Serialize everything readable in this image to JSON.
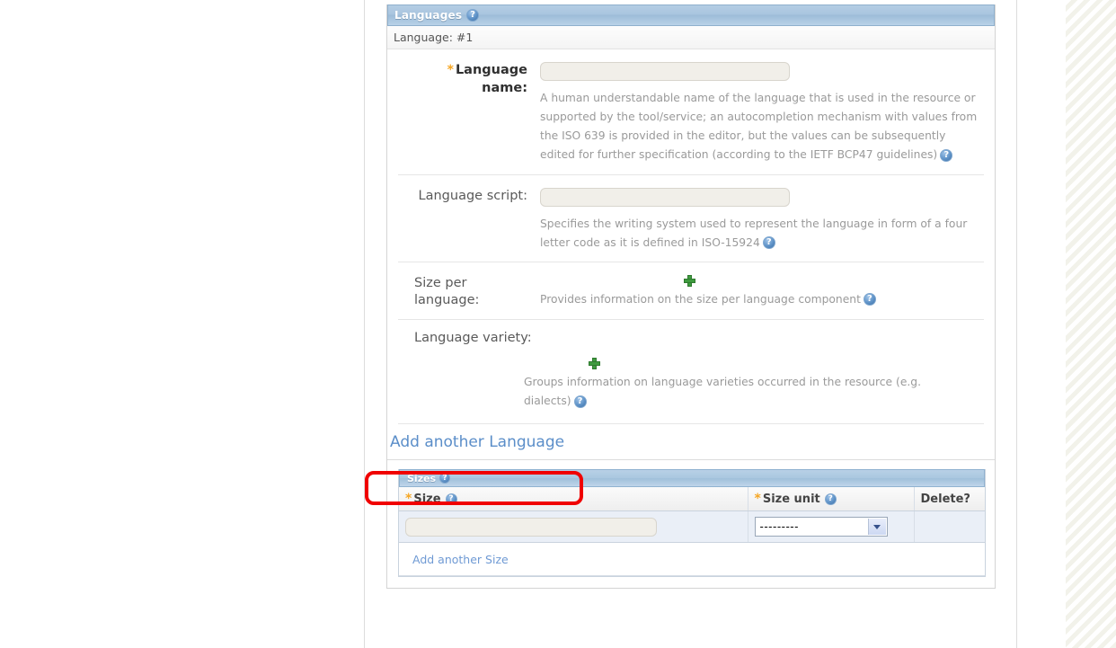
{
  "panel": {
    "title": "Languages",
    "help_icon": "help-icon",
    "subheader": "Language: #1"
  },
  "fields": {
    "language_name": {
      "label": "Language name:",
      "required_marker": "*",
      "value": "",
      "placeholder": "",
      "help": "A human understandable name of the language that is used in the resource or supported by the tool/service; an autocompletion mechanism with values from the ISO 639 is provided in the editor, but the values can be subsequently edited for further specification (according to the IETF BCP47 guidelines)"
    },
    "language_script": {
      "label": "Language script:",
      "value": "",
      "placeholder": "",
      "help": "Specifies the writing system used to represent the language in form of a four letter code as it is defined in ISO-15924"
    },
    "size_per_language": {
      "label": "Size per language:",
      "add_icon": "plus-icon",
      "help": "Provides information on the size per language component"
    },
    "language_variety": {
      "label": "Language variety:",
      "add_icon": "plus-icon",
      "help": "Groups information on language varieties occurred in the resource (e.g. dialects)"
    }
  },
  "add_another_language": "Add another Language",
  "sizes": {
    "title": "Sizes",
    "columns": [
      {
        "label": "Size",
        "required_marker": "*",
        "help_icon": "help-icon"
      },
      {
        "label": "Size unit",
        "required_marker": "*",
        "help_icon": "help-icon"
      },
      {
        "label": "Delete?",
        "required_marker": "",
        "help_icon": ""
      }
    ],
    "rows": [
      {
        "size_value": "",
        "size_placeholder": "",
        "size_unit_selected": "---------",
        "delete_checked": false
      }
    ],
    "add_another": "Add another Size"
  },
  "colors": {
    "panel_header_blue": "#a9c5df",
    "link_blue": "#5b8ec9",
    "required_orange": "#f6a623",
    "annotation_red": "#f00000",
    "plus_green": "#3f9b3f",
    "help_text_gray": "#9a9a9a",
    "table_row_bg": "#eaeff7"
  }
}
